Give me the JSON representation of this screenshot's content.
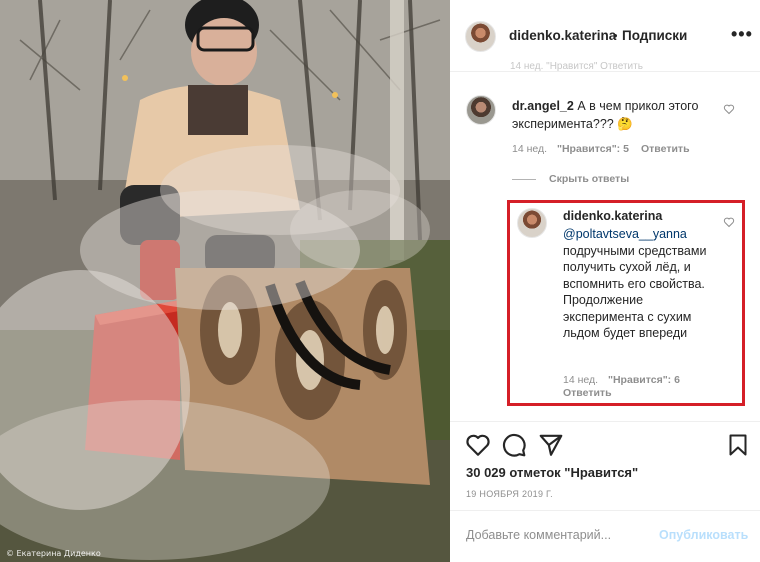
{
  "photo": {
    "credit": "© Екатерина Диденко",
    "description_icon": "photo-experiment"
  },
  "header": {
    "username": "didenko.katerina",
    "separator": "•",
    "follow_label": "Подписки",
    "more_icon": "more-icon"
  },
  "ghost_text": "14 нед.  \"Нравится\"  Ответить",
  "comment": {
    "username": "dr.angel_2",
    "text": "А в чем прикол этого эксперимента??? 🤔",
    "age": "14 нед.",
    "likes": "\"Нравится\": 5",
    "reply": "Ответить"
  },
  "hide_replies": "Скрыть ответы",
  "reply": {
    "username": "didenko.katerina",
    "mention": "@poltavtseva__yanna",
    "text": "подручными средствами получить сухой лёд, и вспомнить его свойства. Продолжение эксперимента с сухим льдом будет впереди",
    "age": "14 нед.",
    "likes": "\"Нравится\": 6",
    "reply": "Ответить"
  },
  "actions": {
    "like_icon": "heart-icon",
    "comment_icon": "comment-icon",
    "share_icon": "share-icon",
    "save_icon": "bookmark-icon"
  },
  "likes_count": "30 029 отметок \"Нравится\"",
  "post_date": "19 НОЯБРЯ 2019 Г.",
  "add_comment": {
    "placeholder": "Добавьте комментарий...",
    "publish_label": "Опубликовать"
  },
  "colors": {
    "highlight_border": "#d51f28",
    "mention": "#00376b",
    "publish_disabled": "#b9dffc"
  }
}
